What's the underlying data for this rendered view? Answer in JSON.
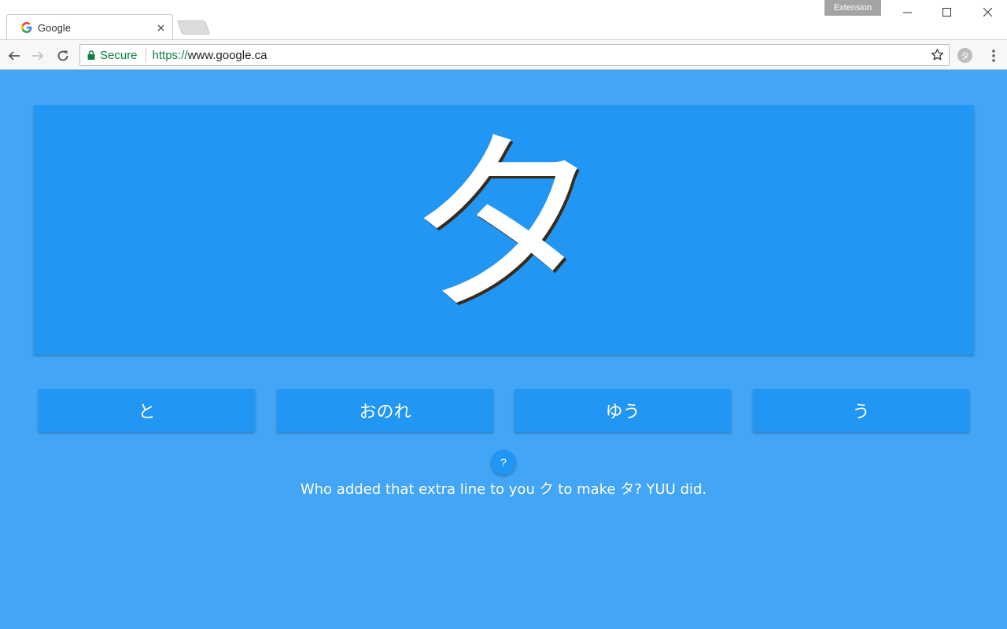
{
  "browser": {
    "tab_title": "Google",
    "extension_badge": "Extension",
    "secure_label": "Secure",
    "url_scheme": "https://",
    "url_host": "www.google.ca",
    "extension_icon_char": "タ",
    "icons": {
      "tab_favicon": "google-g-icon",
      "back": "arrow-left-icon",
      "forward": "arrow-right-icon",
      "reload": "reload-icon",
      "lock": "lock-icon",
      "bookmark": "star-icon",
      "menu": "kebab-menu-icon"
    }
  },
  "quiz": {
    "kana": "タ",
    "answers": [
      "と",
      "おのれ",
      "ゆう",
      "う"
    ],
    "hint_button": "?",
    "hint_text": "Who added that extra line to you ク to make タ? YUU did."
  },
  "colors": {
    "page_background": "#42a5f5",
    "card_background": "#2196f3",
    "secure_green": "#0b8043"
  }
}
